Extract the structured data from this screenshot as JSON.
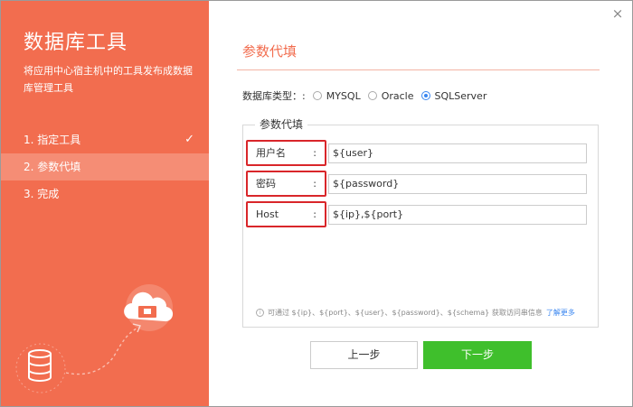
{
  "window": {
    "close_glyph": "×"
  },
  "sidebar": {
    "title": "数据库工具",
    "description": "将应用中心宿主机中的工具发布成数据库管理工具",
    "steps": [
      {
        "label": "1. 指定工具",
        "done": true,
        "active": false
      },
      {
        "label": "2. 参数代填",
        "done": false,
        "active": true
      },
      {
        "label": "3. 完成",
        "done": false,
        "active": false
      }
    ],
    "check_glyph": "✓",
    "illustration_icons": [
      "database-icon",
      "cloud-upload-icon"
    ]
  },
  "main": {
    "title": "参数代填",
    "db_type": {
      "label": "数据库类型：:",
      "options": [
        "MYSQL",
        "Oracle",
        "SQLServer"
      ],
      "selected": "SQLServer"
    },
    "params": {
      "legend": "参数代填",
      "colon": ":",
      "rows": [
        {
          "label": "用户名",
          "value": "${user}"
        },
        {
          "label": "密码",
          "value": "${password}"
        },
        {
          "label": "Host",
          "value": "${ip},${port}"
        }
      ]
    },
    "hint": {
      "icon": "i",
      "text": "可通过 ${ip}、${port}、${user}、${password}、${schema} 获取访问串信息",
      "link": "了解更多"
    },
    "buttons": {
      "prev": "上一步",
      "next": "下一步"
    }
  },
  "colors": {
    "accent": "#f26d4f",
    "next_button": "#3fbf2c",
    "highlight_box": "#d9262a",
    "radio": "#3b87f0"
  }
}
